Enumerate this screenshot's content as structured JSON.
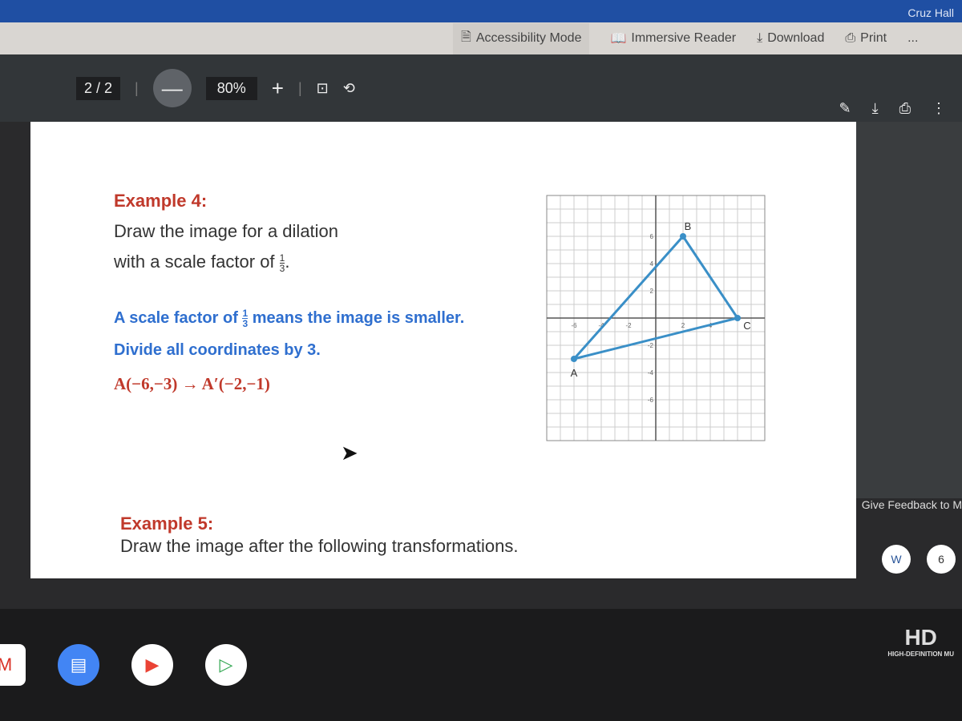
{
  "user": "Cruz Hall",
  "office_toolbar": [
    {
      "label": "Accessibility Mode",
      "icon": "accessibility-icon"
    },
    {
      "label": "Immersive Reader",
      "icon": "immersive-reader-icon"
    },
    {
      "label": "Download",
      "icon": "download-icon"
    },
    {
      "label": "Print",
      "icon": "print-icon"
    },
    {
      "label": "...",
      "icon": "more-icon"
    }
  ],
  "pdf": {
    "page": "2 / 2",
    "zoom": "80%",
    "minus": "—",
    "plus": "+"
  },
  "example4": {
    "title": "Example 4:",
    "line1": "Draw the image for a dilation",
    "line2": "with a scale factor of",
    "frac_num": "1",
    "frac_den": "3"
  },
  "explain": {
    "line1a": "A scale factor of",
    "line1b": "means the image is smaller.",
    "line2": "Divide all coordinates by 3.",
    "frac_num": "1",
    "frac_den": "3"
  },
  "mapping": "A(−6,−3) → A′(−2,−1)",
  "example5": {
    "title": "Example 5:",
    "line": "Draw the image after the following transformations."
  },
  "graph": {
    "xticks": [
      "-6",
      "-4",
      "-2",
      "2",
      "4"
    ],
    "yticks": [
      "6",
      "4",
      "2",
      "-2",
      "-4",
      "-6"
    ],
    "points": [
      {
        "label": "A",
        "x": -6,
        "y": -3
      },
      {
        "label": "B",
        "x": 2,
        "y": 6
      },
      {
        "label": "C",
        "x": 6,
        "y": 0
      }
    ],
    "color": "#3a8fc7"
  },
  "feedback": "Give Feedback to M",
  "badge": "6",
  "hd_logo": "HD",
  "hd_sub": "HIGH-DEFINITION MU"
}
